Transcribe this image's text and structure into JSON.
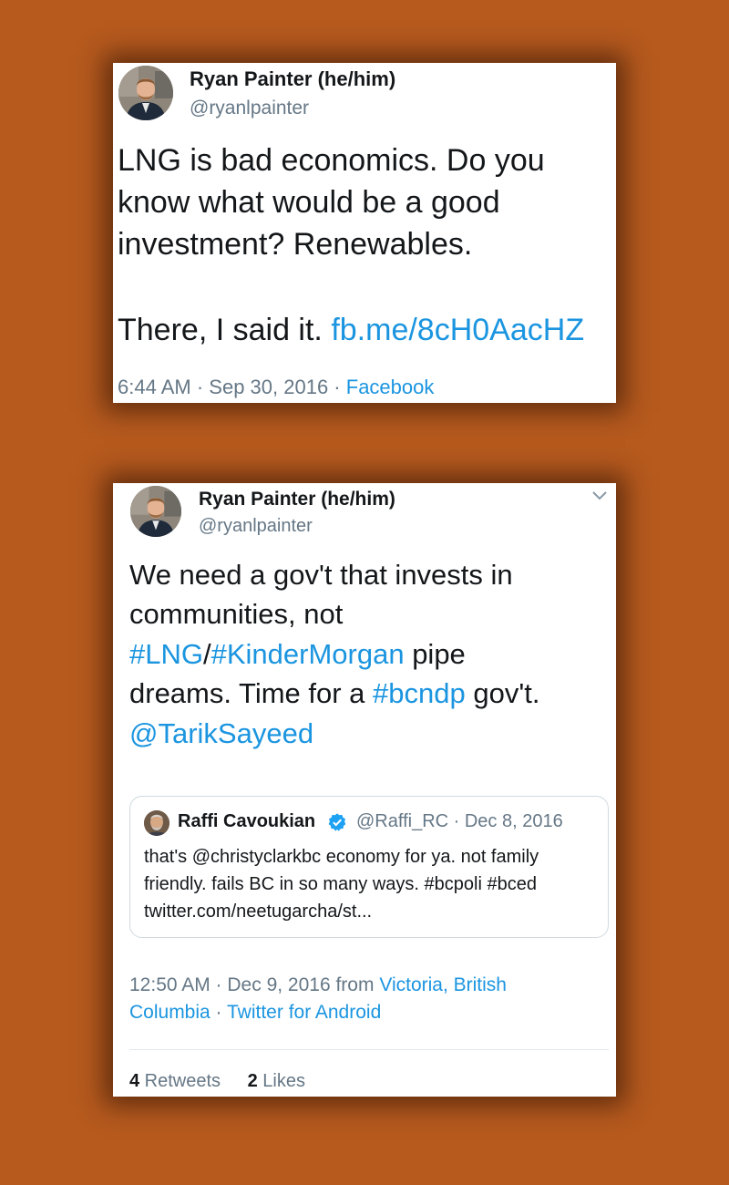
{
  "tweet1": {
    "author_name": "Ryan Painter (he/him)",
    "author_handle": "@ryanlpainter",
    "lines": [
      "LNG is bad economics. Do you",
      "know what would be a good",
      "investment? Renewables."
    ],
    "line4_text": "There, I said it. ",
    "link": "fb.me/8cH0AacHZ",
    "time": "6:44 AM",
    "sep": " · ",
    "date": "Sep 30, 2016",
    "source": "Facebook"
  },
  "tweet2": {
    "author_name": "Ryan Painter (he/him)",
    "author_handle": "@ryanlpainter",
    "line1": "We need a gov't that invests in",
    "line2": "communities, not",
    "hashtag_lng": "#LNG",
    "slash": "/",
    "hashtag_km": "#KinderMorgan",
    "line3_tail": " pipe",
    "line4_head": "dreams. Time for a ",
    "hashtag_bcndp": "#bcndp",
    "line4_tail": " gov't.",
    "mention": "@TarikSayeed",
    "quote": {
      "name": "Raffi Cavoukian",
      "handle_date": "@Raffi_RC · Dec 8, 2016",
      "lines": [
        "that's @christyclarkbc economy for ya. not family",
        "friendly. fails BC in so many ways. #bcpoli #bced",
        "twitter.com/neetugarcha/st..."
      ]
    },
    "time_date": "12:50 AM · Dec 9, 2016 from ",
    "location_part1": "Victoria, British",
    "location_part2": "Columbia",
    "sep": " · ",
    "source": "Twitter for Android",
    "retweets_count": "4",
    "retweets_label": " Retweets",
    "likes_count": "2",
    "likes_label": " Likes"
  },
  "colors": {
    "background": "#b65a1e",
    "link": "#1b95e0",
    "secondary_text": "#657786",
    "verified": "#1da1f2"
  },
  "icons": [
    "avatar-photo",
    "chevron-down-icon",
    "verified-badge-icon"
  ]
}
